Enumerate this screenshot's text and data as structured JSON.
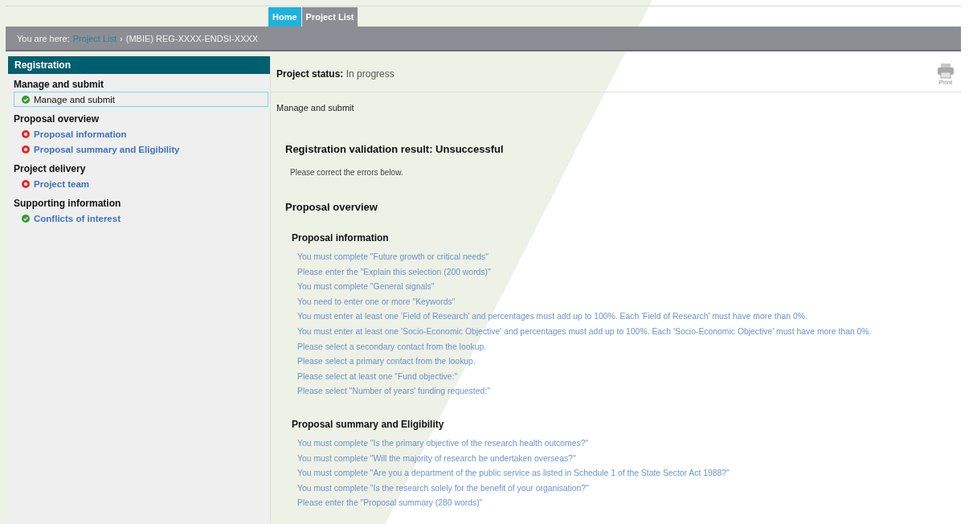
{
  "tabs": [
    {
      "label": "Home",
      "selected": true
    },
    {
      "label": "Project List",
      "selected": false
    }
  ],
  "breadcrumb": {
    "prefix": "You are here:",
    "link": "Project List",
    "separator": "›",
    "current": "(MBIE) REG-XXXX-ENDSI-XXXX"
  },
  "sidebar": {
    "title": "Registration",
    "groups": [
      {
        "heading": "Manage and submit",
        "items": [
          {
            "label": "Manage and submit",
            "kind": "complete",
            "selected": true
          }
        ]
      },
      {
        "heading": "Proposal overview",
        "items": [
          {
            "label": "Proposal information",
            "kind": "error",
            "selected": false
          },
          {
            "label": "Proposal summary and Eligibility",
            "kind": "error",
            "selected": false
          }
        ]
      },
      {
        "heading": "Project delivery",
        "items": [
          {
            "label": "Project team",
            "kind": "error",
            "selected": false
          }
        ]
      },
      {
        "heading": "Supporting information",
        "items": [
          {
            "label": "Conflicts of interest",
            "kind": "complete",
            "selected": false
          }
        ]
      }
    ]
  },
  "status": {
    "label": "Project status:",
    "value": "In progress"
  },
  "print_button": {
    "label": "Print"
  },
  "page_title": "Manage and submit",
  "validation": {
    "heading": "Registration validation result: Unsuccessful",
    "message": "Please correct the errors below.",
    "section_heading": "Proposal overview",
    "sections": [
      {
        "heading": "Proposal information",
        "errors": [
          "You must complete \"Future growth or critical needs\"",
          "Please enter the \"Explain this selection (200 words)\"",
          "You must complete \"General signals\"",
          "You need to enter one or more \"Keywords\"",
          "You must enter at least one 'Field of Research' and percentages must add up to 100%. Each 'Field of Research' must have more than 0%.",
          "You must enter at least one 'Socio-Economic Objective' and percentages must add up to 100%. Each 'Socio-Economic Objective' must have more than 0%.",
          "Please select a secondary contact from the lookup.",
          "Please select a primary contact from the lookup.",
          "Please select at least one \"Fund objective:\"",
          "Please select \"Number of years' funding requested:\""
        ]
      },
      {
        "heading": "Proposal summary and Eligibility",
        "errors": [
          "You must complete \"Is the primary objective of the research health outcomes?\"",
          "You must complete \"Will the majority of research be undertaken overseas?\"",
          "You must complete \"Are you a department of the public service as listed in Schedule 1 of the State Sector Act 1988?\"",
          "You must complete \"Is the research solely for the benefit of your organisation?\"",
          "Please enter the \"Proposal summary (280 words)\""
        ]
      }
    ]
  }
}
